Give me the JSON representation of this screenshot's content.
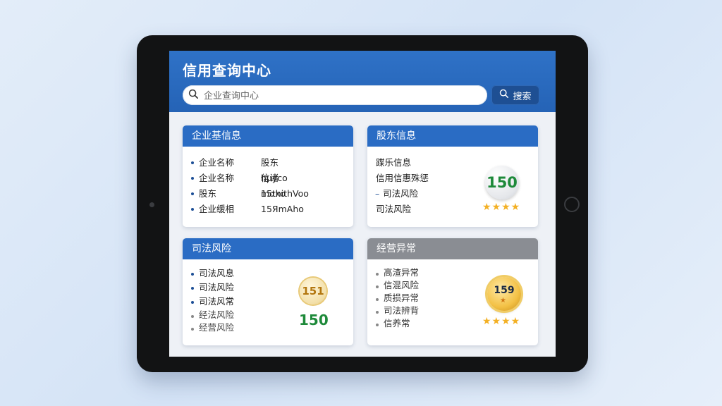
{
  "app": {
    "title": "信用查询中心"
  },
  "search": {
    "placeholder": "企业查询中心",
    "button_label": "搜索"
  },
  "cards": {
    "basic_info": {
      "title": "企业基信息",
      "rows": [
        {
          "label": "企业名称",
          "value": "股东hμyco"
        },
        {
          "label": "企业名称",
          "value": "信诸mαxo"
        },
        {
          "label": "股东",
          "value": "15thithVoo"
        },
        {
          "label": "企业缓相",
          "value": "15ЯmAho"
        }
      ]
    },
    "shareholder": {
      "title": "股东信息",
      "rows": [
        "蹀乐信息",
        "信用信惠殊惩",
        "司法风险",
        "司法风险"
      ],
      "score": "150",
      "stars": "★★★★"
    },
    "judicial_risk": {
      "title": "司法风险",
      "rows": [
        "司法风息",
        "司法风险",
        "司法风常",
        "经法风险",
        "经营风险"
      ],
      "coin_label": "151",
      "score": "150"
    },
    "abnormal": {
      "title": "经营异常",
      "rows": [
        "高渣异常",
        "信混风险",
        "质损异常",
        "司法辨背",
        "信养常"
      ],
      "badge_label": "159",
      "stars": "★★★★"
    }
  },
  "colors": {
    "header_blue": "#2a6cc4",
    "score_green": "#1e8a3a",
    "star_gold": "#f3b024",
    "gray_header": "#8a8d93"
  }
}
